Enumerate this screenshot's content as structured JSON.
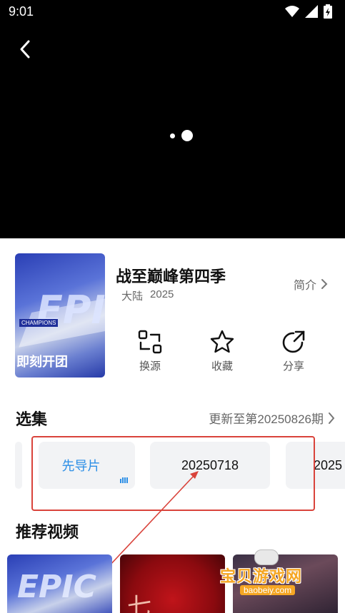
{
  "status_bar": {
    "time": "9:01",
    "icons": [
      "wifi-icon",
      "signal-icon",
      "battery-icon"
    ]
  },
  "player": {
    "back_icon": "chevron-left-icon"
  },
  "show": {
    "poster_lettering": {
      "word": "EPIC",
      "tag": "CHAMPIONS",
      "subtitle": "即刻开团"
    },
    "title": "战至巅峰第四季",
    "region": "大陆",
    "year": "2025",
    "intro_label": "简介"
  },
  "actions": [
    {
      "label": "换源",
      "icon": "switch-source-icon"
    },
    {
      "label": "收藏",
      "icon": "star-icon"
    },
    {
      "label": "分享",
      "icon": "share-icon"
    }
  ],
  "episodes": {
    "section_title": "选集",
    "update_text": "更新至第20250826期",
    "items": [
      {
        "label": "先导片",
        "playing": true
      },
      {
        "label": "20250718",
        "playing": false
      },
      {
        "label": "2025",
        "playing": false
      }
    ]
  },
  "recommended": {
    "section_title": "推荐视频",
    "items": [
      {
        "art_text": "EPIC"
      },
      {
        "art_text": "七"
      },
      {
        "art_text": ""
      }
    ]
  },
  "watermark": {
    "title": "宝贝游戏网",
    "url": "baobeiy.com"
  },
  "colors": {
    "accent": "#2b8ee6",
    "annotation": "#d9433b",
    "watermark": "#f5a623"
  }
}
